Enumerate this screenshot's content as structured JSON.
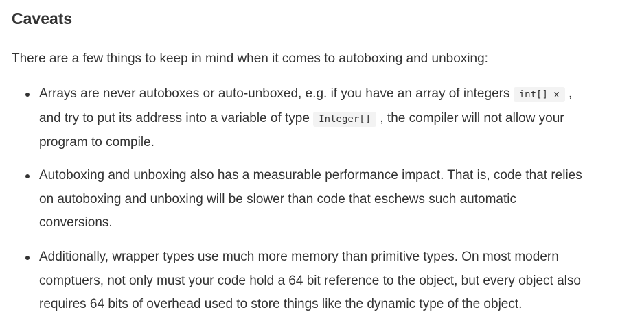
{
  "heading": "Caveats",
  "intro": "There are a few things to keep in mind when it comes to autoboxing and unboxing:",
  "caveats": [
    {
      "l1_before": "Arrays are never autoboxes or auto-unboxed, e.g. if you have an array of integers",
      "l1_code": "int[] x",
      "l1_after": ",",
      "l2_before": "and try to put its address into a variable of type",
      "l2_code": "Integer[]",
      "l2_after": ", the compiler will not allow your",
      "l3": "program to compile."
    },
    {
      "l1": "Autoboxing and unboxing also has a measurable performance impact. That is, code that relies",
      "l2": "on autoboxing and unboxing will be slower than code that eschews such automatic",
      "l3": "conversions."
    },
    {
      "l1": "Additionally, wrapper types use much more memory than primitive types. On most modern",
      "l2": "comptuers, not only must your code hold a 64 bit reference to the object, but every object also",
      "l3": "requires 64 bits of overhead used to store things like the dynamic type of the object."
    }
  ]
}
